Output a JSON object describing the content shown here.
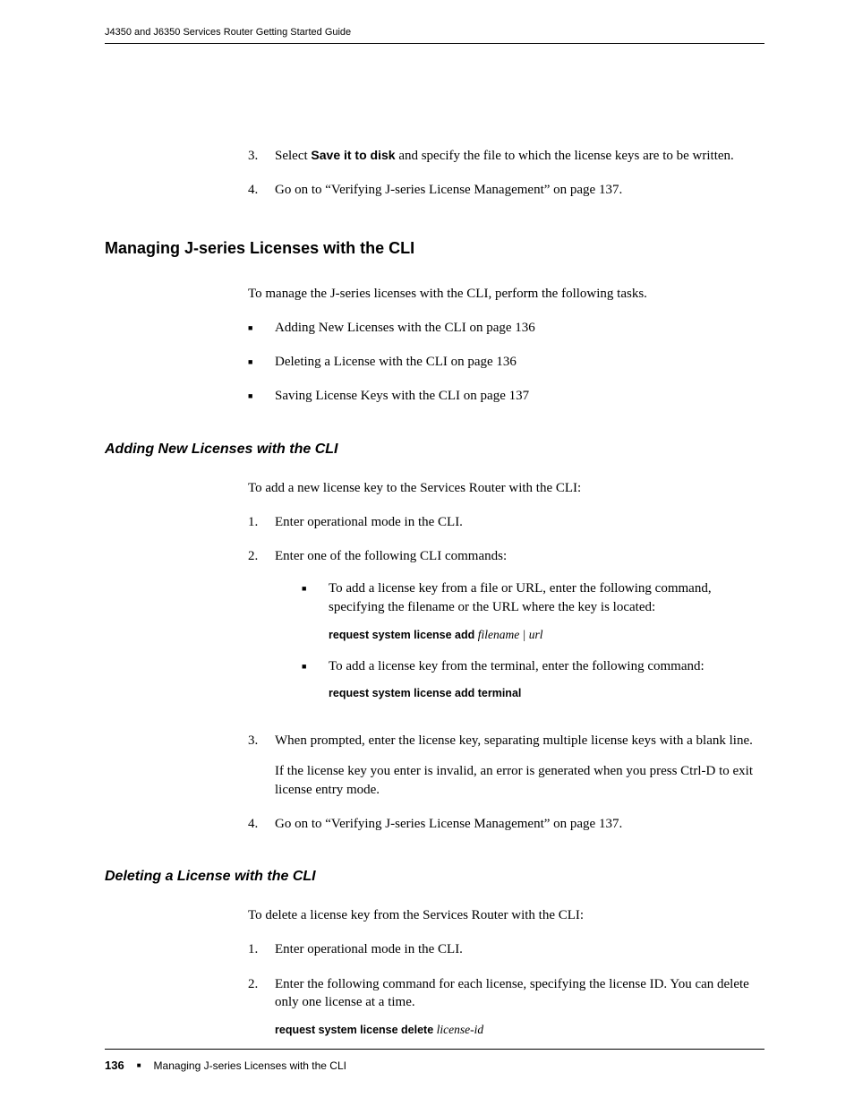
{
  "runningHead": "J4350 and J6350 Services Router Getting Started Guide",
  "topList": {
    "n3": "3.",
    "t3a": "Select ",
    "t3b": "Save it to disk",
    "t3c": " and specify the file to which the license keys are to be written.",
    "n4": "4.",
    "t4": "Go on to “Verifying J-series License Management” on page 137."
  },
  "h1": "Managing J-series Licenses with the CLI",
  "intro1": "To manage the J-series licenses with the CLI, perform the following tasks.",
  "bullets1": {
    "b1": "Adding New Licenses with the CLI on page 136",
    "b2": "Deleting a License with the CLI on page 136",
    "b3": "Saving License Keys with the CLI on page 137"
  },
  "h2a": "Adding New Licenses with the CLI",
  "addIntro": "To add a new license key to the Services Router with the CLI:",
  "add": {
    "n1": "1.",
    "t1": "Enter operational mode in the CLI.",
    "n2": "2.",
    "t2": "Enter one of the following CLI commands:",
    "sub1": "To add a license key from a file or URL, enter the following command, specifying the filename or the URL where the key is located:",
    "cmd1a": "request system license add ",
    "cmd1b": "filename | url",
    "sub2": "To add a license key from the terminal, enter the following command:",
    "cmd2": "request system license add terminal",
    "n3": "3.",
    "t3": "When prompted, enter the license key, separating multiple license keys with a blank line.",
    "t3b": "If the license key you enter is invalid, an error is generated when you press Ctrl-D to exit license entry mode.",
    "n4": "4.",
    "t4": "Go on to “Verifying J-series License Management” on page 137."
  },
  "h2b": "Deleting a License with the CLI",
  "delIntro": "To delete a license key from the Services Router with the CLI:",
  "del": {
    "n1": "1.",
    "t1": "Enter operational mode in the CLI.",
    "n2": "2.",
    "t2": "Enter the following command for each license, specifying the license ID. You can delete only one license at a time.",
    "cmd1a": "request system license delete ",
    "cmd1b": "license-id"
  },
  "footer": {
    "page": "136",
    "text": "Managing J-series Licenses with the CLI"
  }
}
